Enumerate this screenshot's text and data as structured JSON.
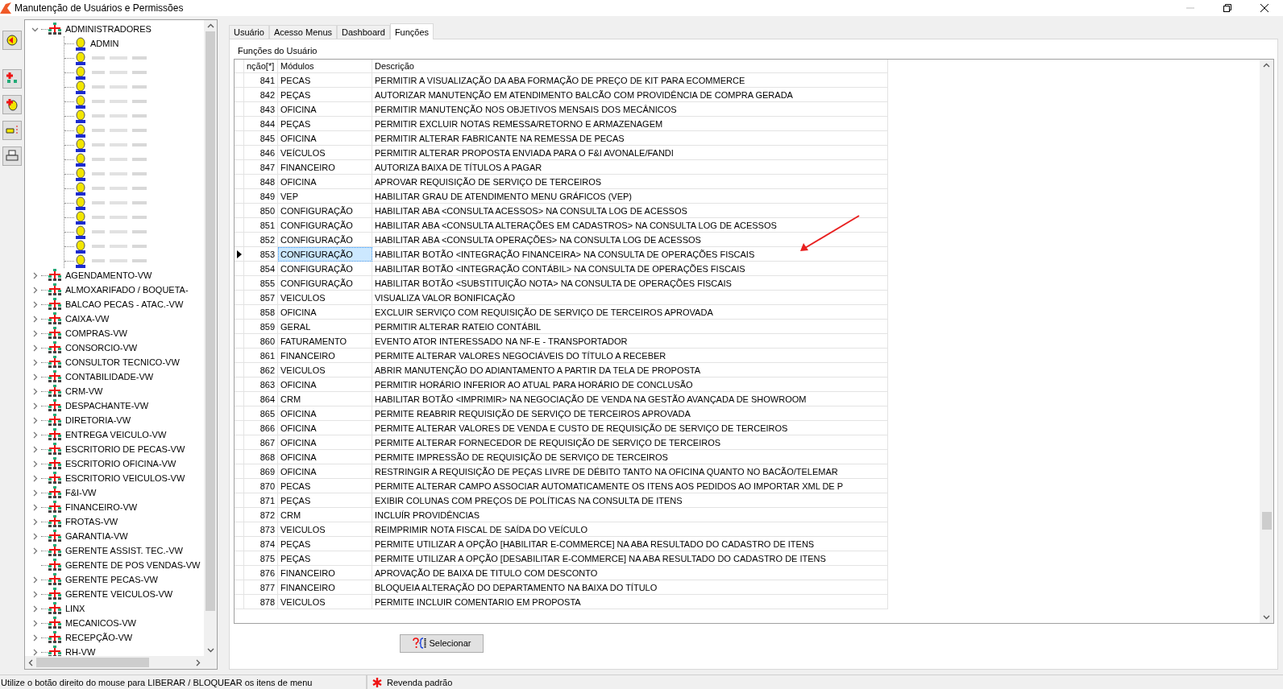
{
  "window": {
    "title": "Manutenção de Usuários e Permissões"
  },
  "tree": {
    "items": [
      {
        "label": "ADMINISTRADORES",
        "expanded": true,
        "leaf": false,
        "children": [
          {
            "kind": "user",
            "label": "ADMIN"
          },
          {
            "kind": "blurred"
          },
          {
            "kind": "blurred"
          },
          {
            "kind": "blurred"
          },
          {
            "kind": "blurred"
          },
          {
            "kind": "blurred"
          },
          {
            "kind": "blurred"
          },
          {
            "kind": "blurred"
          },
          {
            "kind": "blurred"
          },
          {
            "kind": "blurred"
          },
          {
            "kind": "blurred"
          },
          {
            "kind": "blurred"
          },
          {
            "kind": "blurred"
          },
          {
            "kind": "blurred"
          },
          {
            "kind": "blurred"
          },
          {
            "kind": "blurred"
          }
        ]
      },
      {
        "label": "AGENDAMENTO-VW",
        "expanded": false,
        "leaf": false
      },
      {
        "label": "ALMOXARIFADO / BOQUETA-",
        "expanded": false,
        "leaf": false
      },
      {
        "label": "BALCAO PECAS - ATAC.-VW",
        "expanded": false,
        "leaf": false
      },
      {
        "label": "CAIXA-VW",
        "expanded": false,
        "leaf": false
      },
      {
        "label": "COMPRAS-VW",
        "expanded": false,
        "leaf": false
      },
      {
        "label": "CONSORCIO-VW",
        "expanded": false,
        "leaf": false
      },
      {
        "label": "CONSULTOR TECNICO-VW",
        "expanded": false,
        "leaf": false
      },
      {
        "label": "CONTABILIDADE-VW",
        "expanded": false,
        "leaf": false
      },
      {
        "label": "CRM-VW",
        "expanded": false,
        "leaf": false
      },
      {
        "label": "DESPACHANTE-VW",
        "expanded": false,
        "leaf": false
      },
      {
        "label": "DIRETORIA-VW",
        "expanded": false,
        "leaf": false
      },
      {
        "label": "ENTREGA VEICULO-VW",
        "expanded": false,
        "leaf": false
      },
      {
        "label": "ESCRITORIO DE PECAS-VW",
        "expanded": false,
        "leaf": false
      },
      {
        "label": "ESCRITORIO OFICINA-VW",
        "expanded": false,
        "leaf": false
      },
      {
        "label": "ESCRITORIO VEICULOS-VW",
        "expanded": false,
        "leaf": false
      },
      {
        "label": "F&I-VW",
        "expanded": false,
        "leaf": false
      },
      {
        "label": "FINANCEIRO-VW",
        "expanded": false,
        "leaf": false
      },
      {
        "label": "FROTAS-VW",
        "expanded": false,
        "leaf": false
      },
      {
        "label": "GARANTIA-VW",
        "expanded": false,
        "leaf": false
      },
      {
        "label": "GERENTE ASSIST. TEC.-VW",
        "expanded": false,
        "leaf": false
      },
      {
        "label": "GERENTE DE POS VENDAS-VW",
        "expanded": false,
        "leaf": true
      },
      {
        "label": "GERENTE PECAS-VW",
        "expanded": false,
        "leaf": false
      },
      {
        "label": "GERENTE VEICULOS-VW",
        "expanded": false,
        "leaf": false
      },
      {
        "label": "LINX",
        "expanded": false,
        "leaf": false
      },
      {
        "label": "MECANICOS-VW",
        "expanded": false,
        "leaf": false
      },
      {
        "label": "RECEPÇÃO-VW",
        "expanded": false,
        "leaf": false
      },
      {
        "label": "RH-VW",
        "expanded": false,
        "leaf": false
      }
    ]
  },
  "tabs": [
    {
      "label": "Usuário",
      "selected": false
    },
    {
      "label": "Acesso Menus",
      "selected": false
    },
    {
      "label": "Dashboard",
      "selected": false
    },
    {
      "label": "Funções",
      "selected": true
    }
  ],
  "panel": {
    "caption": "Funções do Usuário",
    "table": {
      "columns": [
        "nção[*]",
        "Módulos",
        "Descrição"
      ],
      "rows": [
        {
          "code": "841",
          "module": "PECAS",
          "description": "PERMITIR A VISUALIZAÇÃO DA ABA FORMAÇÃO DE PREÇO DE KIT PARA ECOMMERCE",
          "selected": false
        },
        {
          "code": "842",
          "module": "PEÇAS",
          "description": "AUTORIZAR MANUTENÇÃO EM ATENDIMENTO BALCÃO COM PROVIDÊNCIA DE COMPRA GERADA",
          "selected": false
        },
        {
          "code": "843",
          "module": "OFICINA",
          "description": "PERMITIR MANUTENÇÃO NOS OBJETIVOS MENSAIS DOS MECÂNICOS",
          "selected": false
        },
        {
          "code": "844",
          "module": "PEÇAS",
          "description": "PERMITIR EXCLUIR NOTAS REMESSA/RETORNO E ARMAZENAGEM",
          "selected": false
        },
        {
          "code": "845",
          "module": "OFICINA",
          "description": "PERMITIR ALTERAR FABRICANTE NA REMESSA DE PECAS",
          "selected": false
        },
        {
          "code": "846",
          "module": "VEÍCULOS",
          "description": "PERMITIR ALTERAR PROPOSTA ENVIADA PARA O F&I AVONALE/FANDI",
          "selected": false
        },
        {
          "code": "847",
          "module": "FINANCEIRO",
          "description": "AUTORIZA BAIXA DE TÍTULOS A PAGAR",
          "selected": false
        },
        {
          "code": "848",
          "module": "OFICINA",
          "description": "APROVAR REQUISIÇÃO DE SERVIÇO DE TERCEIROS",
          "selected": false
        },
        {
          "code": "849",
          "module": "VEP",
          "description": "HABILITAR GRAU DE ATENDIMENTO MENU GRÁFICOS (VEP)",
          "selected": false
        },
        {
          "code": "850",
          "module": "CONFIGURAÇÃO",
          "description": "HABILITAR ABA <CONSULTA ACESSOS> NA CONSULTA LOG DE ACESSOS",
          "selected": false
        },
        {
          "code": "851",
          "module": "CONFIGURAÇÃO",
          "description": "HABILITAR ABA <CONSULTA ALTERAÇÕES EM CADASTROS> NA CONSULTA LOG DE ACESSOS",
          "selected": false
        },
        {
          "code": "852",
          "module": "CONFIGURAÇÃO",
          "description": "HABILITAR ABA <CONSULTA OPERAÇÕES> NA CONSULTA LOG DE ACESSOS",
          "selected": false
        },
        {
          "code": "853",
          "module": "CONFIGURAÇÃO",
          "description": "HABILITAR BOTÃO <INTEGRAÇÃO FINANCEIRA> NA CONSULTA DE OPERAÇÕES FISCAIS",
          "selected": true
        },
        {
          "code": "854",
          "module": "CONFIGURAÇÃO",
          "description": "HABILITAR BOTÃO <INTEGRAÇÃO CONTÁBIL> NA CONSULTA DE OPERAÇÕES FISCAIS",
          "selected": false
        },
        {
          "code": "855",
          "module": "CONFIGURAÇÃO",
          "description": "HABILITAR BOTÃO <SUBSTITUIÇÃO NOTA> NA CONSULTA DE OPERAÇÕES FISCAIS",
          "selected": false
        },
        {
          "code": "857",
          "module": "VEICULOS",
          "description": "VISUALIZA VALOR BONIFICAÇÃO",
          "selected": false
        },
        {
          "code": "858",
          "module": "OFICINA",
          "description": "EXCLUIR SERVIÇO COM REQUISIÇÃO DE SERVIÇO DE TERCEIROS APROVADA",
          "selected": false
        },
        {
          "code": "859",
          "module": "GERAL",
          "description": "PERMITIR ALTERAR RATEIO CONTÁBIL",
          "selected": false
        },
        {
          "code": "860",
          "module": "FATURAMENTO",
          "description": "EVENTO ATOR INTERESSADO NA NF-E - TRANSPORTADOR",
          "selected": false
        },
        {
          "code": "861",
          "module": "FINANCEIRO",
          "description": "PERMITE ALTERAR VALORES NEGOCIÁVEIS DO TÍTULO A RECEBER",
          "selected": false
        },
        {
          "code": "862",
          "module": "VEICULOS",
          "description": "ABRIR MANUTENÇÃO DO ADIANTAMENTO A PARTIR DA TELA DE PROPOSTA",
          "selected": false
        },
        {
          "code": "863",
          "module": "OFICINA",
          "description": "PERMITIR HORÁRIO INFERIOR AO ATUAL PARA HORÁRIO DE CONCLUSÃO",
          "selected": false
        },
        {
          "code": "864",
          "module": "CRM",
          "description": "HABILITAR BOTÃO <IMPRIMIR> NA NEGOCIAÇÃO DE VENDA NA GESTÃO AVANÇADA DE SHOWROOM",
          "selected": false
        },
        {
          "code": "865",
          "module": "OFICINA",
          "description": "PERMITE REABRIR REQUISIÇÃO DE SERVIÇO DE TERCEIROS APROVADA",
          "selected": false
        },
        {
          "code": "866",
          "module": "OFICINA",
          "description": "PERMITE ALTERAR VALORES DE VENDA E CUSTO DE REQUISIÇÃO DE SERVIÇO DE TERCEIROS",
          "selected": false
        },
        {
          "code": "867",
          "module": "OFICINA",
          "description": "PERMITE ALTERAR FORNECEDOR DE REQUISIÇÃO DE SERVIÇO DE TERCEIROS",
          "selected": false
        },
        {
          "code": "868",
          "module": "OFICINA",
          "description": "PERMITE IMPRESSÃO DE REQUISIÇÃO DE SERVIÇO DE TERCEIROS",
          "selected": false
        },
        {
          "code": "869",
          "module": "OFICINA",
          "description": "RESTRINGIR A REQUISIÇÃO DE PEÇAS LIVRE DE DÉBITO TANTO NA OFICINA QUANTO NO BACÃO/TELEMAR",
          "selected": false
        },
        {
          "code": "870",
          "module": "PECAS",
          "description": "PERMITE ALTERAR CAMPO ASSOCIAR AUTOMATICAMENTE OS ITENS AOS PEDIDOS AO IMPORTAR XML DE P",
          "selected": false
        },
        {
          "code": "871",
          "module": "PEÇAS",
          "description": "EXIBIR COLUNAS COM PREÇOS DE POLÍTICAS NA CONSULTA DE ITENS",
          "selected": false
        },
        {
          "code": "872",
          "module": "CRM",
          "description": "INCLUÍR PROVIDÊNCIAS",
          "selected": false
        },
        {
          "code": "873",
          "module": "VEICULOS",
          "description": "REIMPRIMIR NOTA FISCAL DE SAÍDA DO VEÍCULO",
          "selected": false
        },
        {
          "code": "874",
          "module": "PEÇAS",
          "description": "PERMITE UTILIZAR A OPÇÃO [HABILITAR E-COMMERCE] NA ABA RESULTADO DO CADASTRO DE ITENS",
          "selected": false
        },
        {
          "code": "875",
          "module": "PEÇAS",
          "description": "PERMITE UTILIZAR A OPÇÃO [DESABILITAR E-COMMERCE] NA ABA RESULTADO DO CADASTRO DE ITENS",
          "selected": false
        },
        {
          "code": "876",
          "module": "FINANCEIRO",
          "description": "APROVAÇÃO DE BAIXA DE TITULO COM DESCONTO",
          "selected": false
        },
        {
          "code": "877",
          "module": "FINANCEIRO",
          "description": "BLOQUEIA ALTERAÇÃO DO DEPARTAMENTO NA BAIXA DO TÍTULO",
          "selected": false
        },
        {
          "code": "878",
          "module": "VEICULOS",
          "description": "PERMITE INCLUIR COMENTARIO EM PROPOSTA",
          "selected": false
        }
      ]
    },
    "button": "Selecionar"
  },
  "status_bar": {
    "hint": "Utilize o botão direito do mouse para LIBERAR / BLOQUEAR os itens de menu",
    "store": "Revenda padrão"
  }
}
